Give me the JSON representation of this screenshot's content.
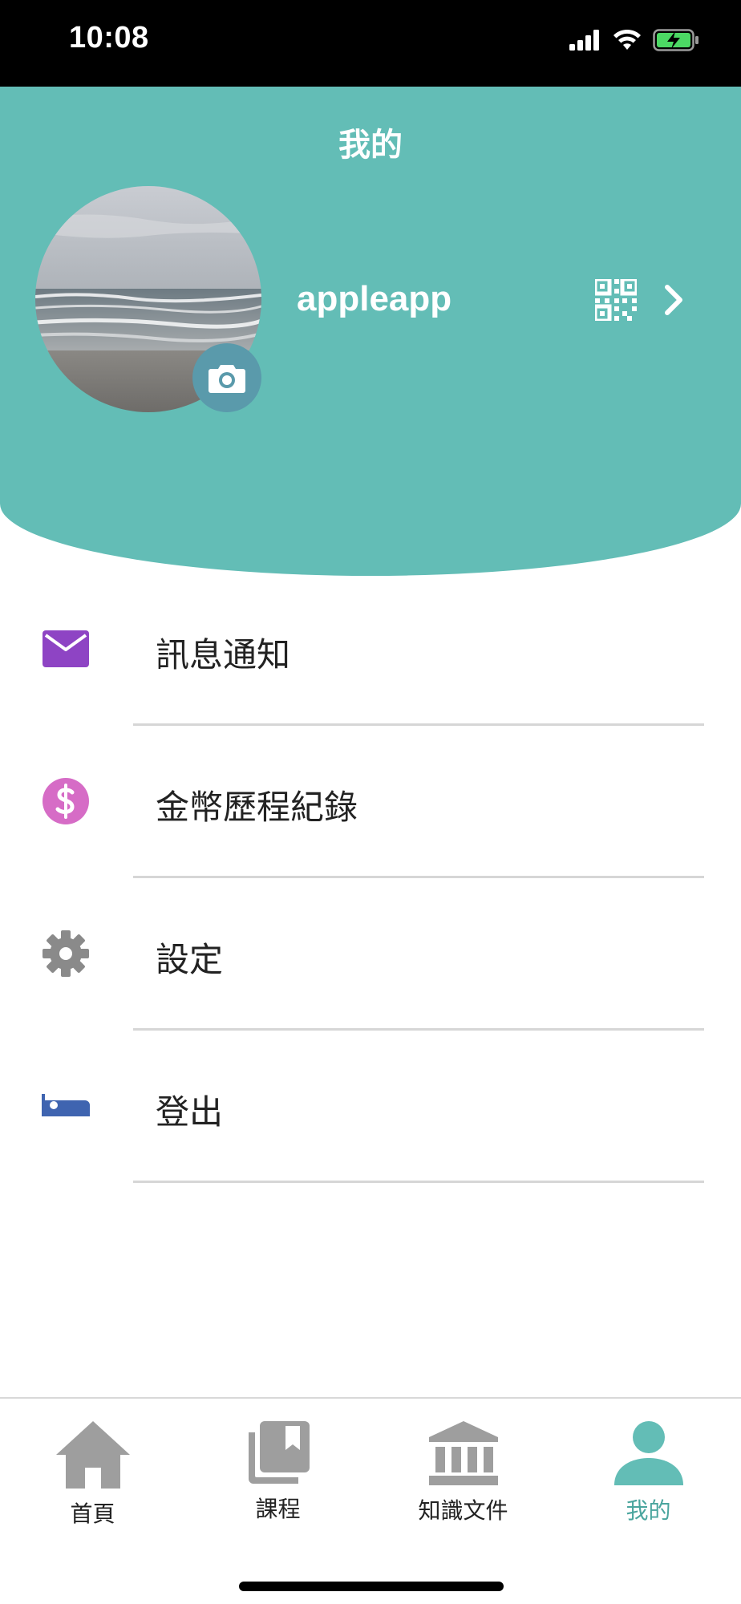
{
  "status_bar": {
    "time": "10:08"
  },
  "header": {
    "title": "我的",
    "username": "appleapp",
    "background_color": "#63bdb6"
  },
  "menu": {
    "items": [
      {
        "label": "訊息通知",
        "icon": "mail-icon",
        "color": "#8e44c4"
      },
      {
        "label": "金幣歷程紀錄",
        "icon": "dollar-icon",
        "color": "#d66cc6"
      },
      {
        "label": "設定",
        "icon": "gear-icon",
        "color": "#8a8a8a"
      },
      {
        "label": "登出",
        "icon": "bed-icon",
        "color": "#3f64b0"
      }
    ]
  },
  "tabbar": {
    "tabs": [
      {
        "label": "首頁",
        "icon": "home-icon"
      },
      {
        "label": "課程",
        "icon": "bookmark-stack-icon"
      },
      {
        "label": "知識文件",
        "icon": "bank-icon"
      },
      {
        "label": "我的",
        "icon": "person-icon",
        "active": true
      }
    ],
    "active_color": "#63bdb6"
  }
}
